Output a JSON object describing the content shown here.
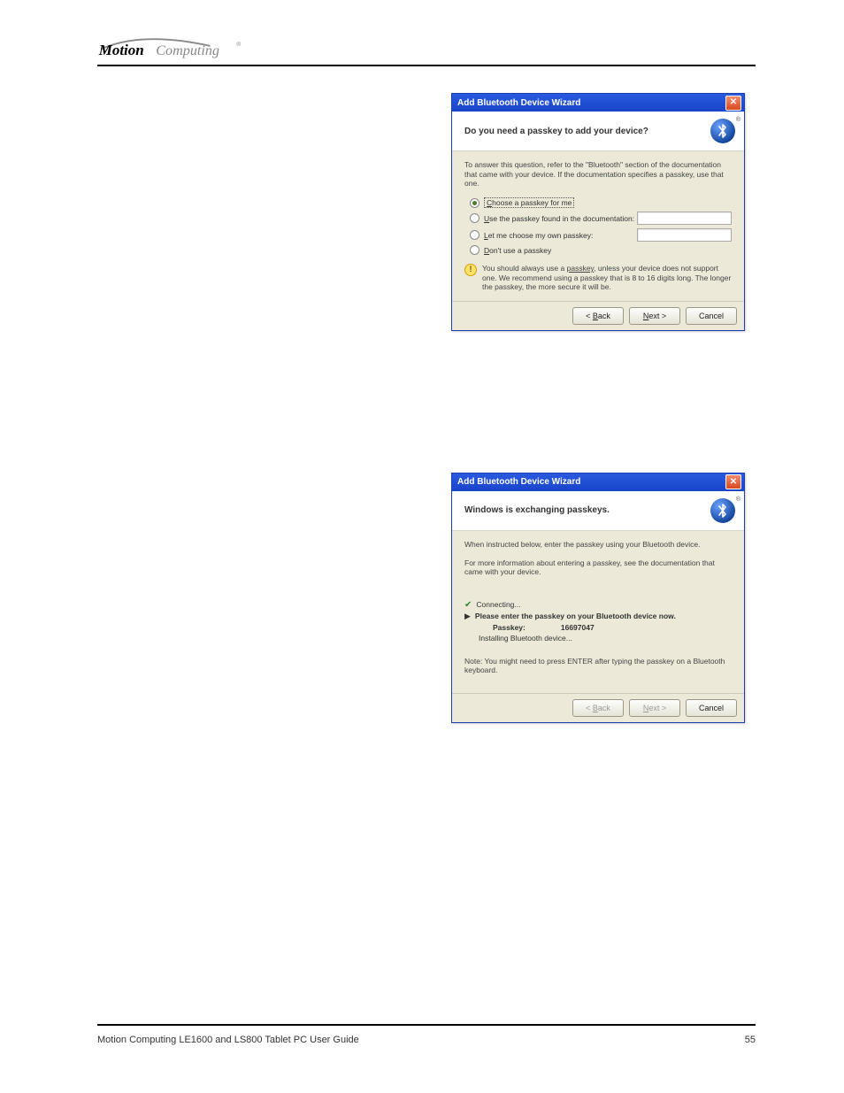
{
  "logo": {
    "motion": "Motion",
    "computing": "Computing",
    "reg": "®"
  },
  "dialog1": {
    "title": "Add Bluetooth Device Wizard",
    "heading": "Do you need a passkey to add your device?",
    "intro": "To answer this question, refer to the \"Bluetooth\" section of the documentation that came with your device. If the documentation specifies a passkey, use that one.",
    "opt1_pre": "C",
    "opt1_rest": "hoose a passkey for me",
    "opt2_pre": "U",
    "opt2_rest": "se the passkey found in the documentation:",
    "opt3_pre": "L",
    "opt3_rest": "et me choose my own passkey:",
    "opt4_pre": "D",
    "opt4_rest": "on't use a passkey",
    "info_a": "You should always use a ",
    "info_link": "passkey",
    "info_b": ", unless your device does not support one. We recommend using a passkey that is 8 to 16 digits long. The longer the passkey, the more secure it will be.",
    "back": "< Back",
    "next": "Next >",
    "cancel": "Cancel"
  },
  "dialog2": {
    "title": "Add Bluetooth Device Wizard",
    "heading": "Windows is exchanging passkeys.",
    "line1": "When instructed below, enter the passkey using your Bluetooth device.",
    "line2": "For more information about entering a passkey, see the documentation that came with your device.",
    "connecting": "Connecting...",
    "enter_now": "Please enter the passkey on your Bluetooth device now.",
    "passkey_label": "Passkey:",
    "passkey_value": "16697047",
    "installing": "Installing Bluetooth device...",
    "note": "Note: You might need to press ENTER after typing the passkey on a Bluetooth keyboard.",
    "back": "< Back",
    "next": "Next >",
    "cancel": "Cancel"
  },
  "footer": {
    "left": "Motion Computing LE1600 and LS800 Tablet PC User Guide",
    "right": "55"
  }
}
